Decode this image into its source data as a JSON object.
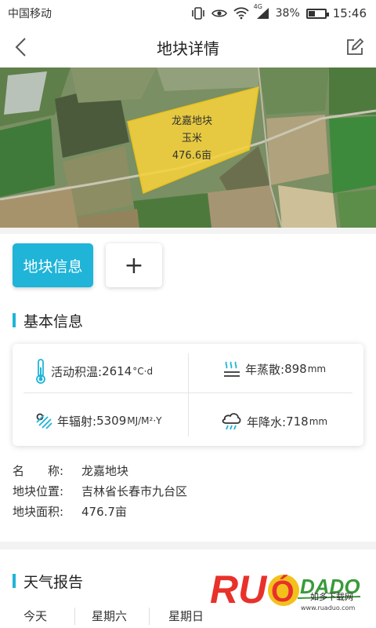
{
  "status_bar": {
    "carrier": "中国移动",
    "network": "4G",
    "battery_percent": "38%",
    "battery_level": 0.38,
    "time": "15:46"
  },
  "nav": {
    "title": "地块详情"
  },
  "map": {
    "plot_name": "龙嘉地块",
    "crop": "玉米",
    "area": "476.6亩",
    "plot_color": "#f5d23b"
  },
  "tabs": {
    "active_label": "地块信息",
    "add_label": "+"
  },
  "basic_info": {
    "heading": "基本信息",
    "metrics": {
      "accumulated_temp": {
        "label": "活动积温:",
        "value": "2614",
        "unit": "°C·d"
      },
      "evaporation": {
        "label": "年蒸散:",
        "value": "898",
        "unit": "mm"
      },
      "radiation": {
        "label": "年辐射:",
        "value": "5309",
        "unit": "MJ/M²·Y"
      },
      "precipitation": {
        "label": "年降水:",
        "value": "718",
        "unit": "mm"
      }
    },
    "details": [
      {
        "label": "名　　称:",
        "value": "龙嘉地块"
      },
      {
        "label": "地块位置:",
        "value": "吉林省长春市九台区"
      },
      {
        "label": "地块面积:",
        "value": "476.7亩"
      }
    ]
  },
  "weather": {
    "heading": "天气报告",
    "tabs": [
      "今天",
      "星期六",
      "星期日"
    ]
  },
  "watermark": {
    "brand": "RUAODADO",
    "slogan": "如多下载网",
    "url": "www.ruaduo.com"
  },
  "colors": {
    "accent": "#1fb4d8",
    "divider": "#f3f3f3"
  }
}
